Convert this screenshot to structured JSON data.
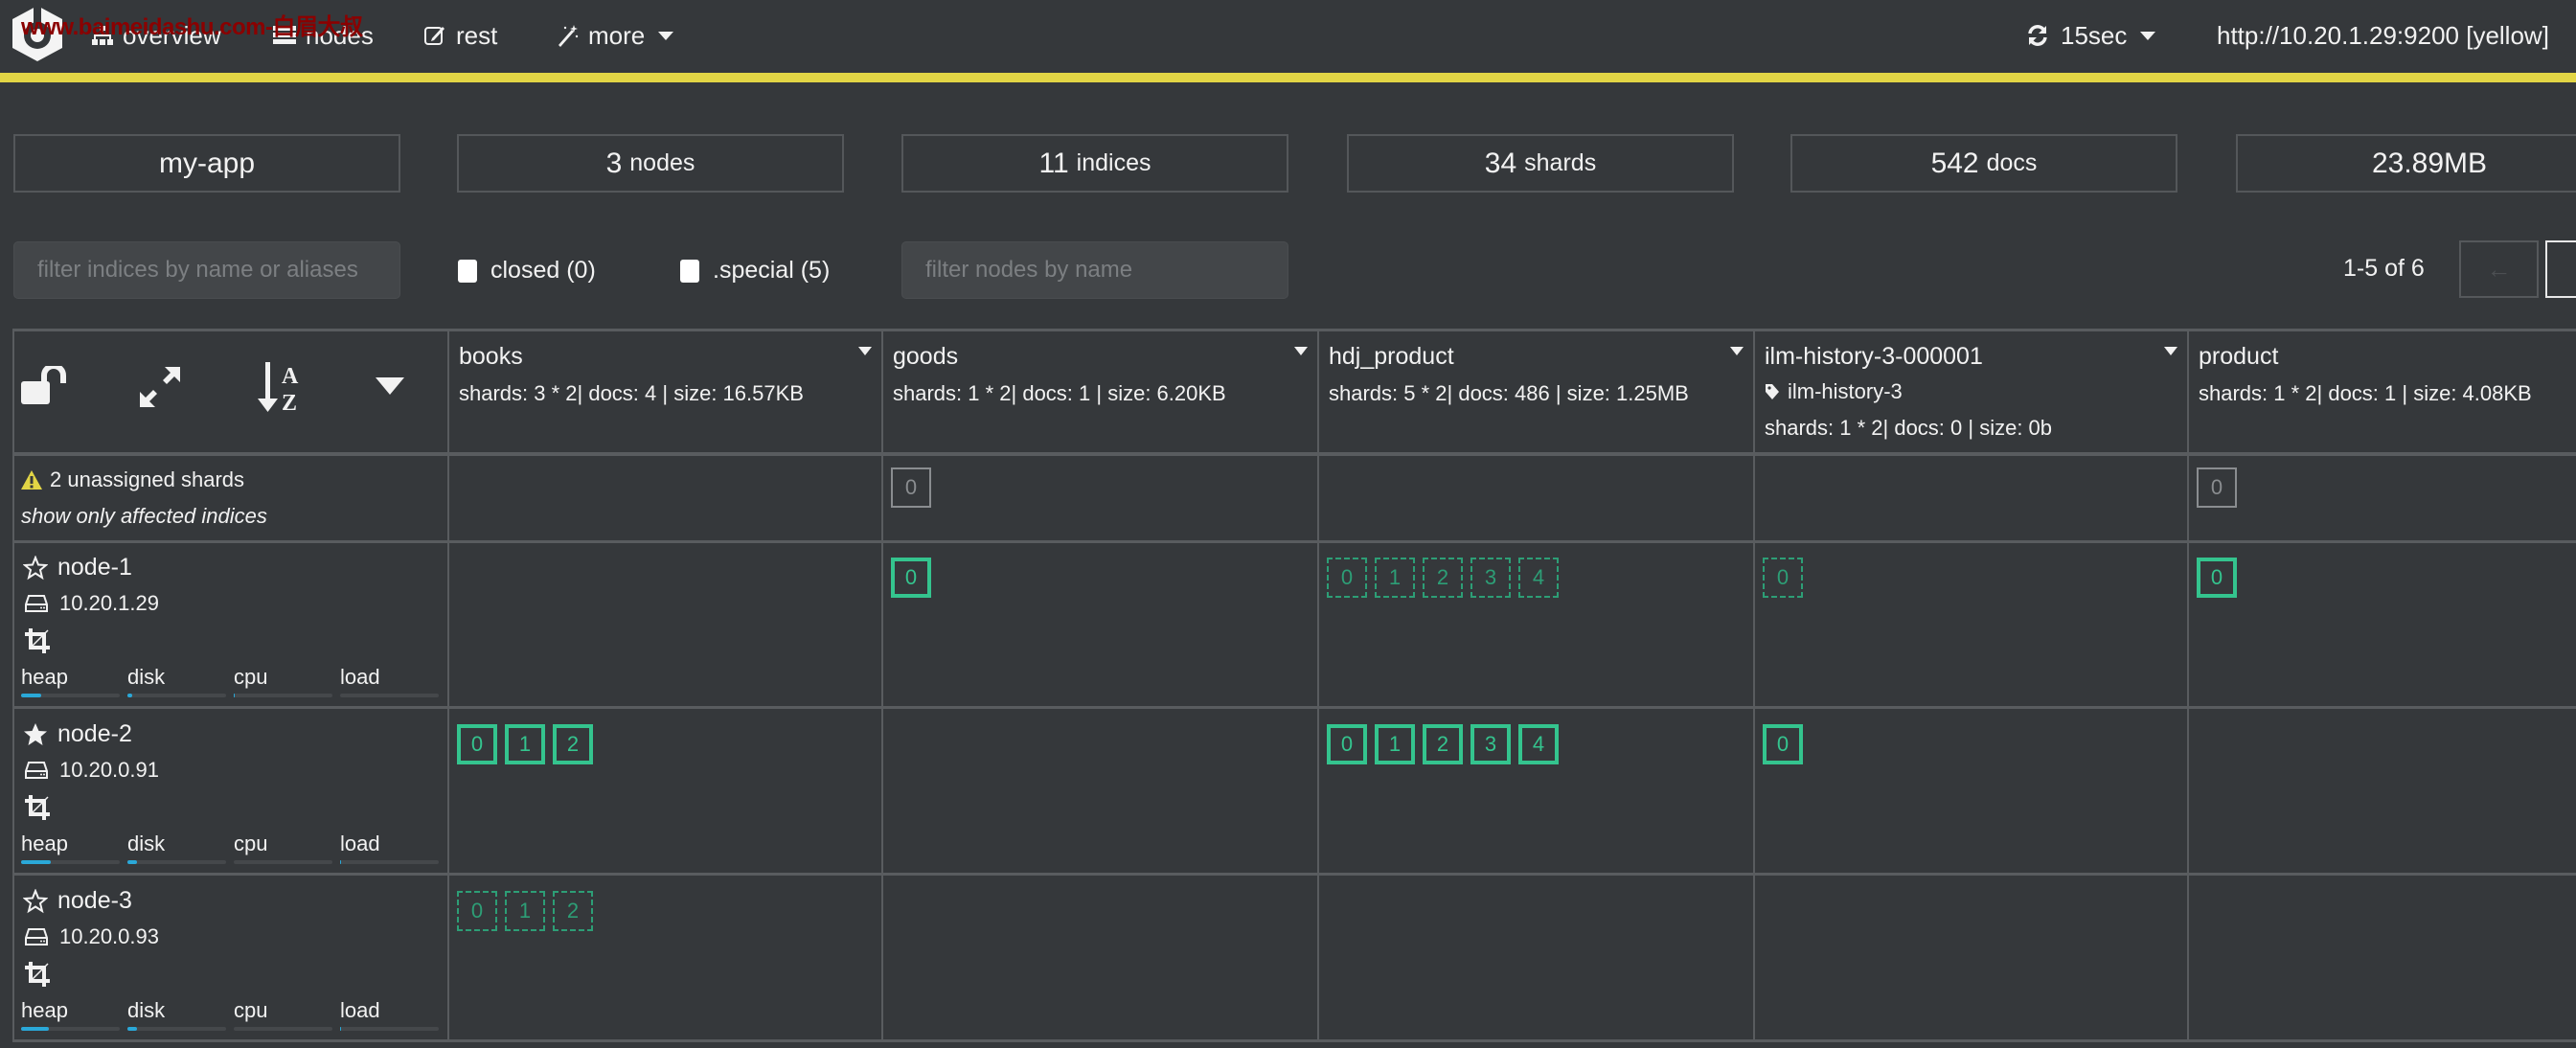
{
  "watermark": "www.baimeidashu.com-白眉大叔",
  "colors": {
    "background": "#35383b",
    "cluster_status": "#e2d545",
    "primary_shard": "#34c48e",
    "replica_shard": "#2d9e76",
    "unassigned_shard": "#8a8d90",
    "metric_bar": "#2aa8d8"
  },
  "nav": {
    "items": [
      {
        "label": "overview",
        "icon": "sitemap-icon"
      },
      {
        "label": "nodes",
        "icon": "server-icon"
      },
      {
        "label": "rest",
        "icon": "edit-icon"
      },
      {
        "label": "more",
        "icon": "magic-wand-icon"
      }
    ],
    "refresh": "15sec",
    "cluster_url": "http://10.20.1.29:9200 [yellow]"
  },
  "stats": {
    "cluster_name": "my-app",
    "nodes": {
      "value": "3",
      "unit": "nodes"
    },
    "indices": {
      "value": "11",
      "unit": "indices"
    },
    "shards": {
      "value": "34",
      "unit": "shards"
    },
    "docs": {
      "value": "542",
      "unit": "docs"
    },
    "size": "23.89MB"
  },
  "filters": {
    "indices_placeholder": "filter indices by name or aliases",
    "closed_label": "closed (0)",
    "special_label": ".special (5)",
    "nodes_placeholder": "filter nodes by name",
    "pagination": "1-5 of 6",
    "prev": "←",
    "next": "→"
  },
  "unassigned": {
    "title": "2 unassigned shards",
    "link": "show only affected indices"
  },
  "indices": [
    {
      "name": "books",
      "stats": "shards: 3 * 2| docs: 4 | size: 16.57KB",
      "alias": null,
      "unassigned": []
    },
    {
      "name": "goods",
      "stats": "shards: 1 * 2| docs: 1 | size: 6.20KB",
      "alias": null,
      "unassigned": [
        "0"
      ]
    },
    {
      "name": "hdj_product",
      "stats": "shards: 5 * 2| docs: 486 | size: 1.25MB",
      "alias": null,
      "unassigned": []
    },
    {
      "name": "ilm-history-3-000001",
      "stats": "shards: 1 * 2| docs: 0 | size: 0b",
      "alias": "ilm-history-3",
      "unassigned": []
    },
    {
      "name": "product",
      "stats": "shards: 1 * 2| docs: 1 | size: 4.08KB",
      "alias": null,
      "unassigned": [
        "0"
      ]
    }
  ],
  "nodes": [
    {
      "name": "node-1",
      "master": false,
      "ip": "10.20.1.29",
      "metrics": [
        {
          "label": "heap",
          "percent": 20
        },
        {
          "label": "disk",
          "percent": 5
        },
        {
          "label": "cpu",
          "percent": 1
        },
        {
          "label": "load",
          "percent": 0
        }
      ],
      "shards": [
        [],
        [
          {
            "id": "0",
            "type": "primary"
          }
        ],
        [
          {
            "id": "0",
            "type": "replica"
          },
          {
            "id": "1",
            "type": "replica"
          },
          {
            "id": "2",
            "type": "replica"
          },
          {
            "id": "3",
            "type": "replica"
          },
          {
            "id": "4",
            "type": "replica"
          }
        ],
        [
          {
            "id": "0",
            "type": "replica"
          }
        ],
        [
          {
            "id": "0",
            "type": "primary"
          }
        ]
      ]
    },
    {
      "name": "node-2",
      "master": true,
      "ip": "10.20.0.91",
      "metrics": [
        {
          "label": "heap",
          "percent": 30
        },
        {
          "label": "disk",
          "percent": 10
        },
        {
          "label": "cpu",
          "percent": 0
        },
        {
          "label": "load",
          "percent": 1
        }
      ],
      "shards": [
        [
          {
            "id": "0",
            "type": "primary"
          },
          {
            "id": "1",
            "type": "primary"
          },
          {
            "id": "2",
            "type": "primary"
          }
        ],
        [],
        [
          {
            "id": "0",
            "type": "primary"
          },
          {
            "id": "1",
            "type": "primary"
          },
          {
            "id": "2",
            "type": "primary"
          },
          {
            "id": "3",
            "type": "primary"
          },
          {
            "id": "4",
            "type": "primary"
          }
        ],
        [
          {
            "id": "0",
            "type": "primary"
          }
        ],
        []
      ]
    },
    {
      "name": "node-3",
      "master": false,
      "ip": "10.20.0.93",
      "metrics": [
        {
          "label": "heap",
          "percent": 28
        },
        {
          "label": "disk",
          "percent": 10
        },
        {
          "label": "cpu",
          "percent": 0
        },
        {
          "label": "load",
          "percent": 1
        }
      ],
      "shards": [
        [
          {
            "id": "0",
            "type": "replica"
          },
          {
            "id": "1",
            "type": "replica"
          },
          {
            "id": "2",
            "type": "replica"
          }
        ],
        [],
        [],
        [],
        []
      ]
    }
  ]
}
